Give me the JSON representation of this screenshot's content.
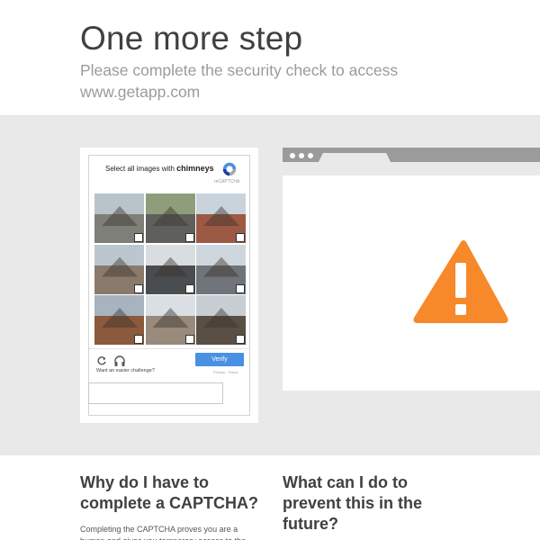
{
  "header": {
    "title": "One more step",
    "subtitle": "Please complete the security check to access www.getapp.com"
  },
  "captcha": {
    "instruction_prefix": "Select all images with",
    "instruction_target": "chimneys",
    "brand": "reCAPTCHA",
    "verify_label": "Verify",
    "easier_label": "Want an easier challenge?",
    "privacy_label": "Privacy - Terms",
    "tiles": [
      {
        "name": "street-with-cars",
        "sky": "#b8c4c9",
        "ground": "#7e7f79"
      },
      {
        "name": "road-with-trees",
        "sky": "#8e9e7a",
        "ground": "#5f5f5d"
      },
      {
        "name": "brick-house-roof",
        "sky": "#c9d3dc",
        "ground": "#9c5a45"
      },
      {
        "name": "stone-house",
        "sky": "#bcc6cf",
        "ground": "#8a7a6c"
      },
      {
        "name": "highway-overpass",
        "sky": "#d8dde0",
        "ground": "#4a4d4f"
      },
      {
        "name": "white-house-roof",
        "sky": "#cfd7de",
        "ground": "#6e7479"
      },
      {
        "name": "brick-chimney",
        "sky": "#a7b4bf",
        "ground": "#8b5a3c"
      },
      {
        "name": "gray-roof-houses",
        "sky": "#d9dfe3",
        "ground": "#9a8a7c"
      },
      {
        "name": "dark-roof-house",
        "sky": "#c6ced4",
        "ground": "#5a4f45"
      }
    ]
  },
  "sections": {
    "why_title": "Why do I have to complete a CAPTCHA?",
    "why_body": "Completing the CAPTCHA proves you are a human and gives you temporary access to the",
    "what_title": "What can I do to prevent this in the future?"
  },
  "colors": {
    "warning": "#f7892a",
    "verify": "#4a90e2",
    "band": "#e9e9e9"
  }
}
